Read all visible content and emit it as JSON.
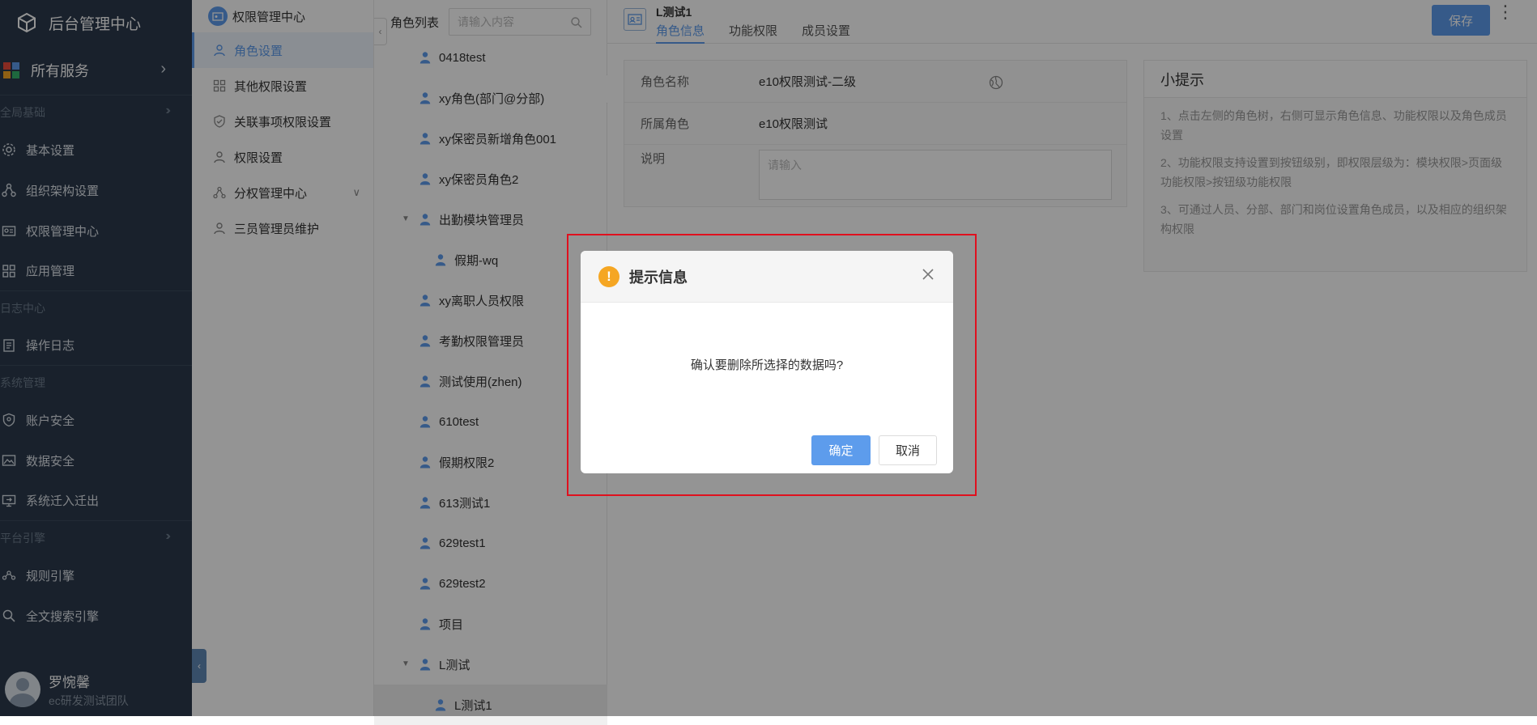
{
  "sidebar": {
    "title": "后台管理中心",
    "services_label": "所有服务",
    "groups": {
      "basic": "全局基础",
      "log": "日志中心",
      "system": "系统管理",
      "engine": "平台引擎"
    },
    "items": {
      "basic_settings": "基本设置",
      "org_settings": "组织架构设置",
      "perm_center": "权限管理中心",
      "app_mgmt": "应用管理",
      "op_log": "操作日志",
      "account_security": "账户安全",
      "data_security": "数据安全",
      "migration": "系统迁入迁出",
      "rule_engine": "规则引擎",
      "search_engine": "全文搜索引擎"
    },
    "user": {
      "name": "罗惋馨",
      "team": "ec研发测试团队"
    }
  },
  "submenu": {
    "title": "权限管理中心",
    "items": [
      "角色设置",
      "其他权限设置",
      "关联事项权限设置",
      "权限设置",
      "分权管理中心",
      "三员管理员维护"
    ]
  },
  "tree": {
    "title": "角色列表",
    "search_placeholder": "请输入内容",
    "nodes": [
      "0418test",
      "xy角色(部门@分部)",
      "xy保密员新增角色001",
      "xy保密员角色2",
      "出勤模块管理员",
      "假期-wq",
      "xy离职人员权限",
      "考勤权限管理员",
      "测试使用(zhen)",
      "610test",
      "假期权限2",
      "613测试1",
      "629test1",
      "629test2",
      "项目",
      "L测试",
      "L测试1"
    ]
  },
  "main": {
    "role_title": "L测试1",
    "tabs": [
      "角色信息",
      "功能权限",
      "成员设置"
    ],
    "save_label": "保存",
    "form": {
      "name_label": "角色名称",
      "name_value": "e10权限测试-二级",
      "parent_label": "所属角色",
      "parent_value": "e10权限测试",
      "desc_label": "说明",
      "desc_placeholder": "请输入"
    },
    "tips": {
      "title": "小提示",
      "items": [
        "1、点击左侧的角色树，右侧可显示角色信息、功能权限以及角色成员设置",
        "2、功能权限支持设置到按钮级别，即权限层级为：模块权限>页面级功能权限>按钮级功能权限",
        "3、可通过人员、分部、部门和岗位设置角色成员，以及相应的组织架构权限"
      ]
    }
  },
  "dialog": {
    "title": "提示信息",
    "message": "确认要删除所选择的数据吗?",
    "ok_label": "确定",
    "cancel_label": "取消"
  },
  "colors": {
    "sidebar_bg": "#2b3a4c",
    "accent": "#5d9cec",
    "warning": "#f5a623",
    "highlight": "#e0101e"
  }
}
